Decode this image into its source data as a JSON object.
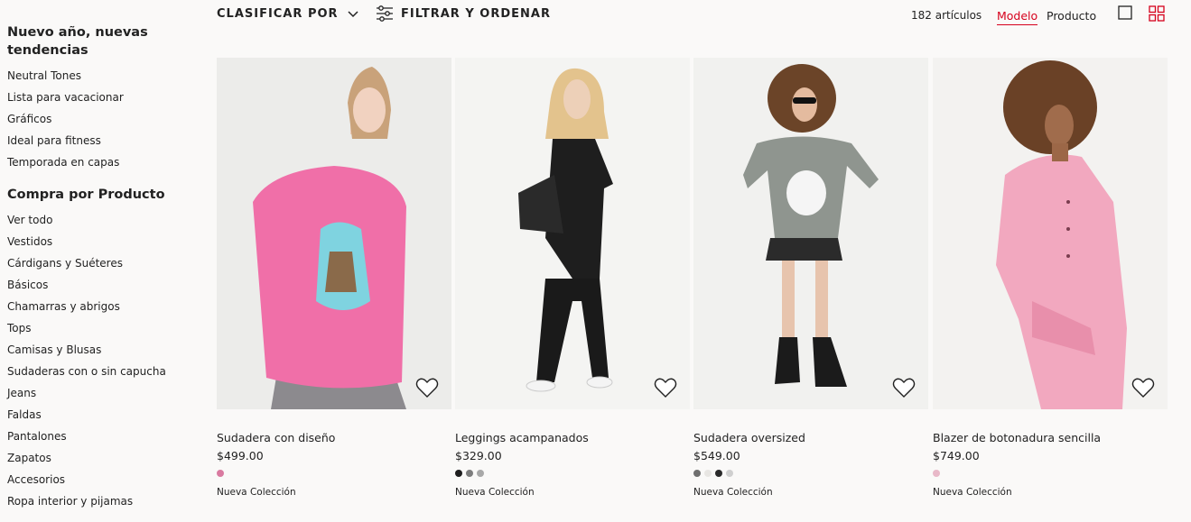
{
  "sidebar": {
    "section1": {
      "title": "Nuevo año, nuevas tendencias",
      "items": [
        "Neutral Tones",
        "Lista para vacacionar",
        "Gráficos",
        "Ideal para fitness",
        "Temporada en capas"
      ]
    },
    "section2": {
      "title": "Compra por Producto",
      "items": [
        "Ver todo",
        "Vestidos",
        "Cárdigans y Suéteres",
        "Básicos",
        "Chamarras y abrigos",
        "Tops",
        "Camisas y Blusas",
        "Sudaderas con o sin capucha",
        "Jeans",
        "Faldas",
        "Pantalones",
        "Zapatos",
        "Accesorios",
        "Ropa interior y pijamas"
      ]
    }
  },
  "toolbar": {
    "sort_label": "CLASIFICAR POR",
    "filter_label": "FILTRAR Y ORDENAR",
    "count": "182 artículos",
    "view_model": "Modelo",
    "view_product": "Producto"
  },
  "icons": {
    "sort": "chevron-down-icon",
    "filter": "sliders-icon",
    "grid_single": "square-icon",
    "grid_multi": "grid-four-icon",
    "favorite": "heart-icon"
  },
  "colors": {
    "accent": "#d6001c",
    "background": "#faf9f8"
  },
  "products": [
    {
      "name": "Sudadera con diseño",
      "price": "$499.00",
      "swatches": [
        "#d97aa0"
      ],
      "tag": "Nueva Colección"
    },
    {
      "name": "Leggings acampanados",
      "price": "$329.00",
      "swatches": [
        "#1e1e1e",
        "#7d7d7d",
        "#a8a8a8"
      ],
      "tag": "Nueva Colección"
    },
    {
      "name": "Sudadera oversized",
      "price": "$549.00",
      "swatches": [
        "#6f6f6f",
        "#e8e6e3",
        "#2a2a2a",
        "#cfcfcf"
      ],
      "tag": "Nueva Colección"
    },
    {
      "name": "Blazer de botonadura sencilla",
      "price": "$749.00",
      "swatches": [
        "#e8b8c8"
      ],
      "tag": "Nueva Colección"
    }
  ]
}
